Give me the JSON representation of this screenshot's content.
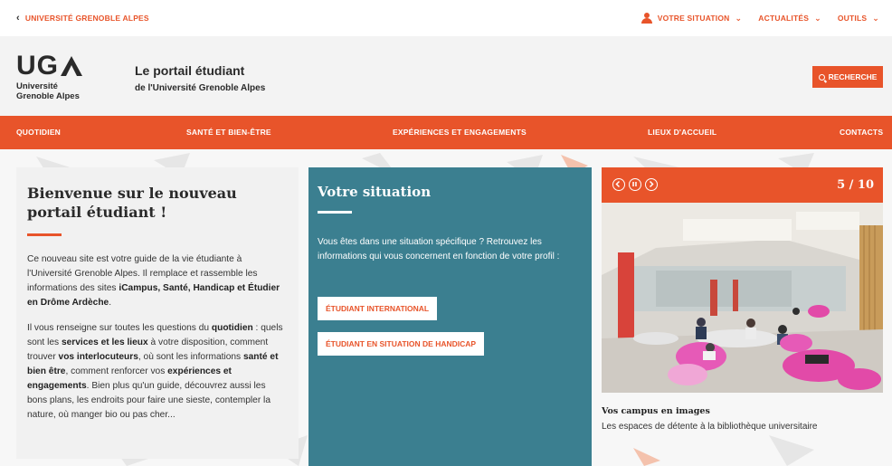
{
  "topbar": {
    "back_label": "UNIVERSITÉ GRENOBLE ALPES",
    "nav": [
      {
        "label": "VOTRE SITUATION",
        "icon": "user-icon"
      },
      {
        "label": "ACTUALITÉS"
      },
      {
        "label": "OUTILS"
      }
    ]
  },
  "header": {
    "logo_mark": "UG",
    "logo_line1": "Université",
    "logo_line2": "Grenoble Alpes",
    "title": "Le portail étudiant",
    "subtitle": "de l'Université Grenoble Alpes",
    "search_label": "RECHERCHE"
  },
  "mainnav": {
    "items": [
      {
        "label": "QUOTIDIEN"
      },
      {
        "label": "SANTÉ ET BIEN-ÊTRE"
      },
      {
        "label": "EXPÉRIENCES ET ENGAGEMENTS"
      },
      {
        "label": "LIEUX D'ACCUEIL"
      },
      {
        "label": "CONTACTS"
      }
    ]
  },
  "welcome": {
    "title": "Bienvenue sur le nouveau portail étudiant !",
    "p1_a": "Ce nouveau site est votre guide de la vie étudiante à l'Université Grenoble Alpes. Il remplace et rassemble les informations des sites ",
    "p1_b": "iCampus, Santé, Handicap et Étudier en Drôme Ardèche",
    "p1_c": ".",
    "p2_a": "Il vous renseigne sur toutes les questions du ",
    "p2_b": "quotidien",
    "p2_c": " : quels sont les ",
    "p2_d": "services et les lieux",
    "p2_e": " à votre disposition, comment trouver ",
    "p2_f": "vos interlocuteurs",
    "p2_g": ", où sont les informations ",
    "p2_h": "santé et bien être",
    "p2_i": ", comment renforcer vos ",
    "p2_j": "expériences et engagements",
    "p2_k": ". Bien plus qu'un guide, découvrez aussi les bons plans, les endroits pour faire une sieste, contempler la nature, où manger bio ou pas cher..."
  },
  "situation": {
    "title": "Votre situation",
    "text": "Vous êtes dans une situation spécifique ? Retrouvez les informations qui vous concernent en fonction de votre profil :",
    "buttons": [
      {
        "label": "ÉTUDIANT INTERNATIONAL"
      },
      {
        "label": "ÉTUDIANT EN SITUATION DE HANDICAP"
      }
    ]
  },
  "slider": {
    "counter": "5 / 10",
    "caption_title": "Vos campus en images",
    "caption_text": "Les espaces de détente à la bibliothèque universitaire"
  },
  "colors": {
    "accent": "#e8542a",
    "teal": "#3b7f90",
    "header_bg": "#f3f3f3"
  }
}
